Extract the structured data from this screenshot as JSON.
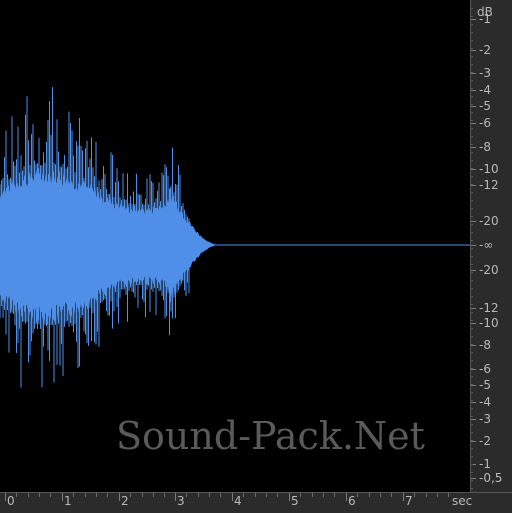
{
  "watermark": "Sound-Pack.Net",
  "waveform_color": "#4f8fe8",
  "db_ruler": {
    "unit": "dB",
    "labels": [
      "-1",
      "-2",
      "-3",
      "-4",
      "-5",
      "-6",
      "-8",
      "-10",
      "-12",
      "-20",
      "-∞",
      "-20",
      "-12",
      "-10",
      "-8",
      "-6",
      "-5",
      "-4",
      "-3",
      "-2",
      "-1",
      "-0,5"
    ]
  },
  "time_ruler": {
    "unit": "sec",
    "labels": [
      "0",
      "1",
      "2",
      "3",
      "4",
      "5",
      "6",
      "7"
    ]
  }
}
